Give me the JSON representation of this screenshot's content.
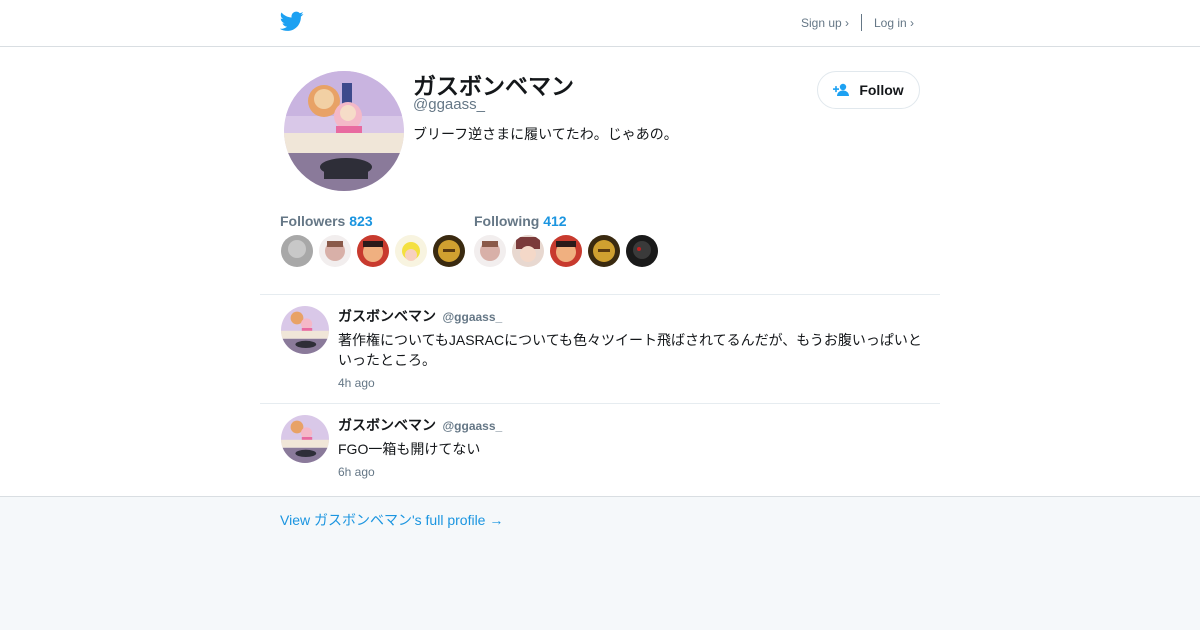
{
  "header": {
    "logo_icon": "twitter-bird-icon",
    "sign_up_label": "Sign up ›",
    "log_in_label": "Log in ›"
  },
  "profile": {
    "display_name": "ガスボンベマン",
    "handle": "@ggaass_",
    "bio": "ブリーフ逆さまに履いてたわ。じゃあの。",
    "follow_label": "Follow",
    "follow_icon": "add-person-icon"
  },
  "stats": {
    "followers_label": "Followers",
    "followers_count": "823",
    "following_label": "Following",
    "following_count": "412"
  },
  "tweets": [
    {
      "name": "ガスボンベマン",
      "handle": "@ggaass_",
      "text": "著作権についてもJASRACについても色々ツイート飛ばされてるんだが、もうお腹いっぱいといったところ。",
      "time": "4h ago"
    },
    {
      "name": "ガスボンベマン",
      "handle": "@ggaass_",
      "text": "FGO一箱も開けてない",
      "time": "6h ago"
    }
  ],
  "footer": {
    "full_profile_link": "View ガスボンベマン's full profile →"
  },
  "colors": {
    "brand_blue": "#1da1f2",
    "link_blue": "#1b95e0",
    "muted_text": "#657786",
    "page_background": "#f5f8fa"
  }
}
